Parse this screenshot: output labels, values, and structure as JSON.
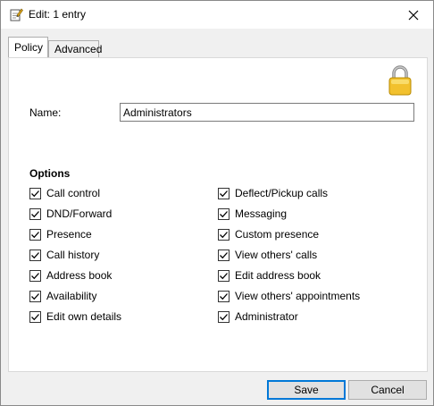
{
  "window": {
    "title": "Edit: 1 entry"
  },
  "tabs": [
    {
      "label": "Policy",
      "active": true
    },
    {
      "label": "Advanced",
      "active": false
    }
  ],
  "form": {
    "name_label": "Name:",
    "name_value": "Administrators"
  },
  "options": {
    "title": "Options",
    "left": [
      {
        "label": "Call control",
        "checked": true
      },
      {
        "label": "DND/Forward",
        "checked": true
      },
      {
        "label": "Presence",
        "checked": true
      },
      {
        "label": "Call history",
        "checked": true
      },
      {
        "label": "Address book",
        "checked": true
      },
      {
        "label": "Availability",
        "checked": true
      },
      {
        "label": "Edit own details",
        "checked": true
      }
    ],
    "right": [
      {
        "label": "Deflect/Pickup calls",
        "checked": true
      },
      {
        "label": "Messaging",
        "checked": true
      },
      {
        "label": "Custom presence",
        "checked": true
      },
      {
        "label": "View others' calls",
        "checked": true
      },
      {
        "label": "Edit address book",
        "checked": true
      },
      {
        "label": "View others' appointments",
        "checked": true
      },
      {
        "label": "Administrator",
        "checked": true
      }
    ]
  },
  "buttons": {
    "save": "Save",
    "cancel": "Cancel"
  },
  "colors": {
    "accent": "#0078d7",
    "lock": "#f2c12e"
  }
}
